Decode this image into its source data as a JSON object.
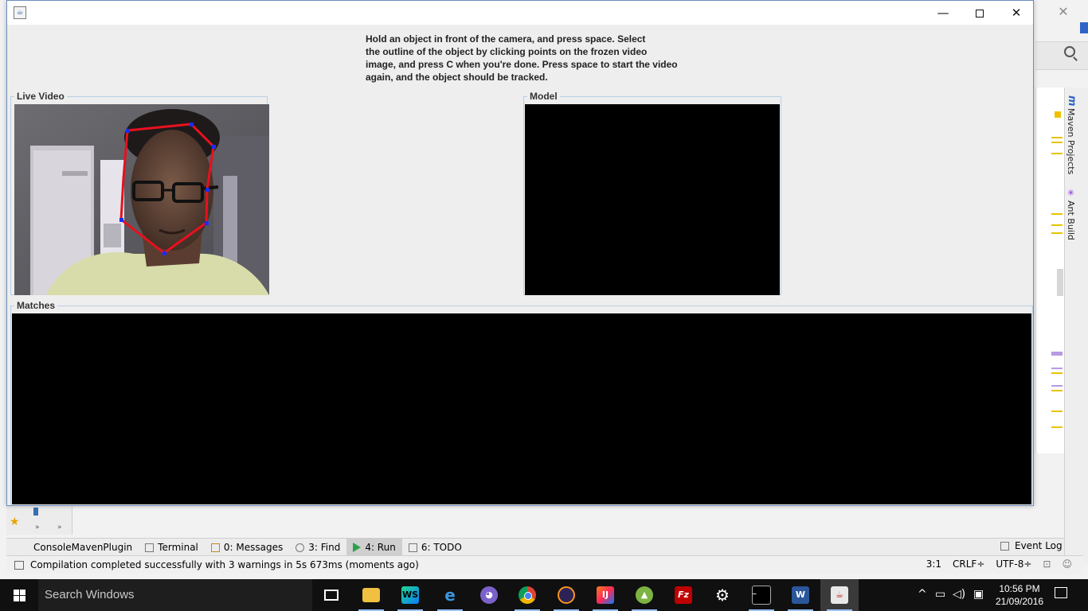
{
  "window": {
    "app_icon": "java-window-icon",
    "minimize": "—",
    "close": "✕"
  },
  "instructions": [
    "Hold an object in front of the camera, and press space. Select",
    "the outline of the object by clicking points on the frozen video",
    "image, and press C when you're done. Press space to start the video",
    "again, and the object should be tracked."
  ],
  "panels": {
    "live_video": "Live Video",
    "model": "Model",
    "matches": "Matches"
  },
  "colors": {
    "outline": "#e8101e",
    "outline_points": "#1a2cff",
    "panel_border": "#b8cfe5"
  },
  "ide": {
    "right_tabs": [
      "Maven Projects",
      "Ant Build"
    ],
    "tool_tabs": [
      {
        "label": "ConsoleMavenPlugin",
        "icon": "none"
      },
      {
        "label": "Terminal",
        "icon": "terminal-icon"
      },
      {
        "label": "0: Messages",
        "icon": "messages-icon"
      },
      {
        "label": "3: Find",
        "icon": "find-icon"
      },
      {
        "label": "4: Run",
        "icon": "run-icon"
      },
      {
        "label": "6: TODO",
        "icon": "todo-icon"
      }
    ],
    "event_log": "Event Log",
    "status_message": "Compilation completed successfully with 3 warnings in 5s 673ms (moments ago)",
    "status_right": [
      "3:1",
      "CRLF÷",
      "UTF-8÷"
    ]
  },
  "taskbar": {
    "search_placeholder": "Search Windows",
    "apps": [
      "task-view-icon",
      "file-explorer-icon",
      "webstorm-icon",
      "edge-icon",
      "github-desktop-icon",
      "chrome-icon",
      "eclipse-icon",
      "intellij-icon",
      "android-studio-icon",
      "filezilla-icon",
      "settings-icon",
      "cmd-icon",
      "word-icon",
      "java-icon"
    ],
    "time": "10:56 PM",
    "date": "21/09/2016"
  }
}
